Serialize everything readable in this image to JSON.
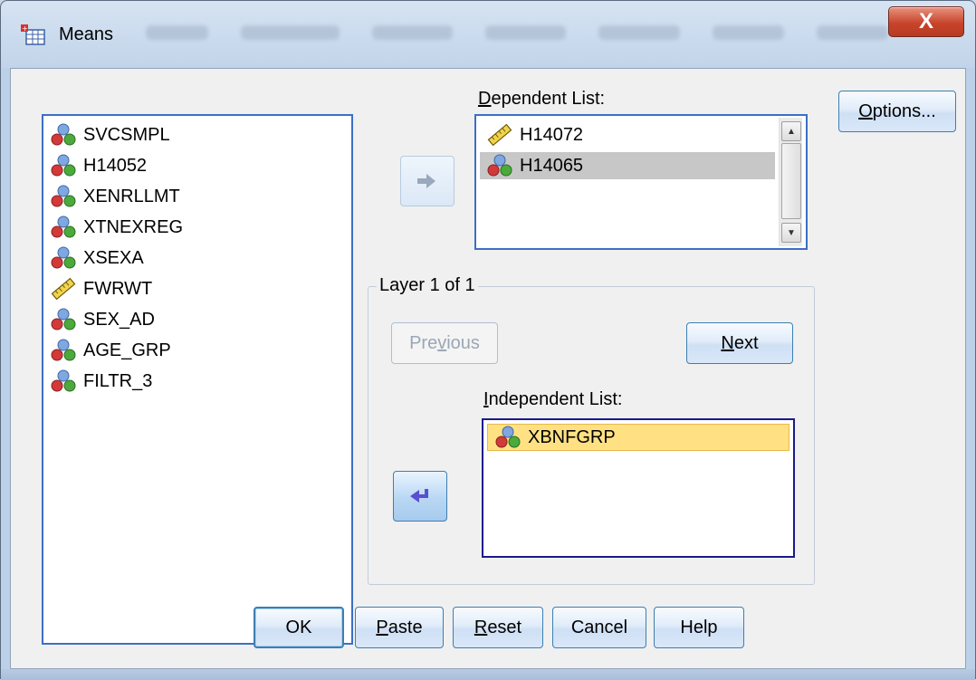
{
  "window": {
    "title": "Means",
    "close_label": "X"
  },
  "variables": {
    "items": [
      {
        "label": "SVCSMPL",
        "icon": "nominal-variable-icon"
      },
      {
        "label": "H14052",
        "icon": "nominal-variable-icon"
      },
      {
        "label": "XENRLLMT",
        "icon": "nominal-variable-icon"
      },
      {
        "label": "XTNEXREG",
        "icon": "nominal-variable-icon"
      },
      {
        "label": "XSEXA",
        "icon": "nominal-variable-icon"
      },
      {
        "label": "FWRWT",
        "icon": "scale-variable-icon"
      },
      {
        "label": "SEX_AD",
        "icon": "nominal-variable-icon"
      },
      {
        "label": "AGE_GRP",
        "icon": "nominal-variable-icon"
      },
      {
        "label": "FILTR_3",
        "icon": "nominal-variable-icon"
      }
    ]
  },
  "dependent_list": {
    "label_prefix": "",
    "label_underlined": "D",
    "label_rest": "ependent List:",
    "items": [
      {
        "label": "H14072",
        "icon": "scale-variable-icon"
      },
      {
        "label": "H14065",
        "icon": "nominal-variable-icon",
        "selected": true
      }
    ]
  },
  "layer": {
    "title": "Layer 1 of 1",
    "previous_pre": "Pre",
    "previous_u": "v",
    "previous_post": "ious",
    "next_u": "N",
    "next_rest": "ext"
  },
  "independent_list": {
    "label_prefix": "",
    "label_underlined": "I",
    "label_rest": "ndependent List:",
    "items": [
      {
        "label": "XBNFGRP",
        "icon": "nominal-variable-icon",
        "selected": true
      }
    ]
  },
  "buttons": {
    "options_u": "O",
    "options_rest": "ptions...",
    "ok": "OK",
    "paste_u": "P",
    "paste_rest": "aste",
    "reset_u": "R",
    "reset_rest": "eset",
    "cancel": "Cancel",
    "help": "Help"
  },
  "colors": {
    "listbox_border": "#3c6fc4",
    "selected_gray": "#c7c7c7",
    "selected_yellow": "#ffe184",
    "button_border": "#3c7fb1"
  }
}
